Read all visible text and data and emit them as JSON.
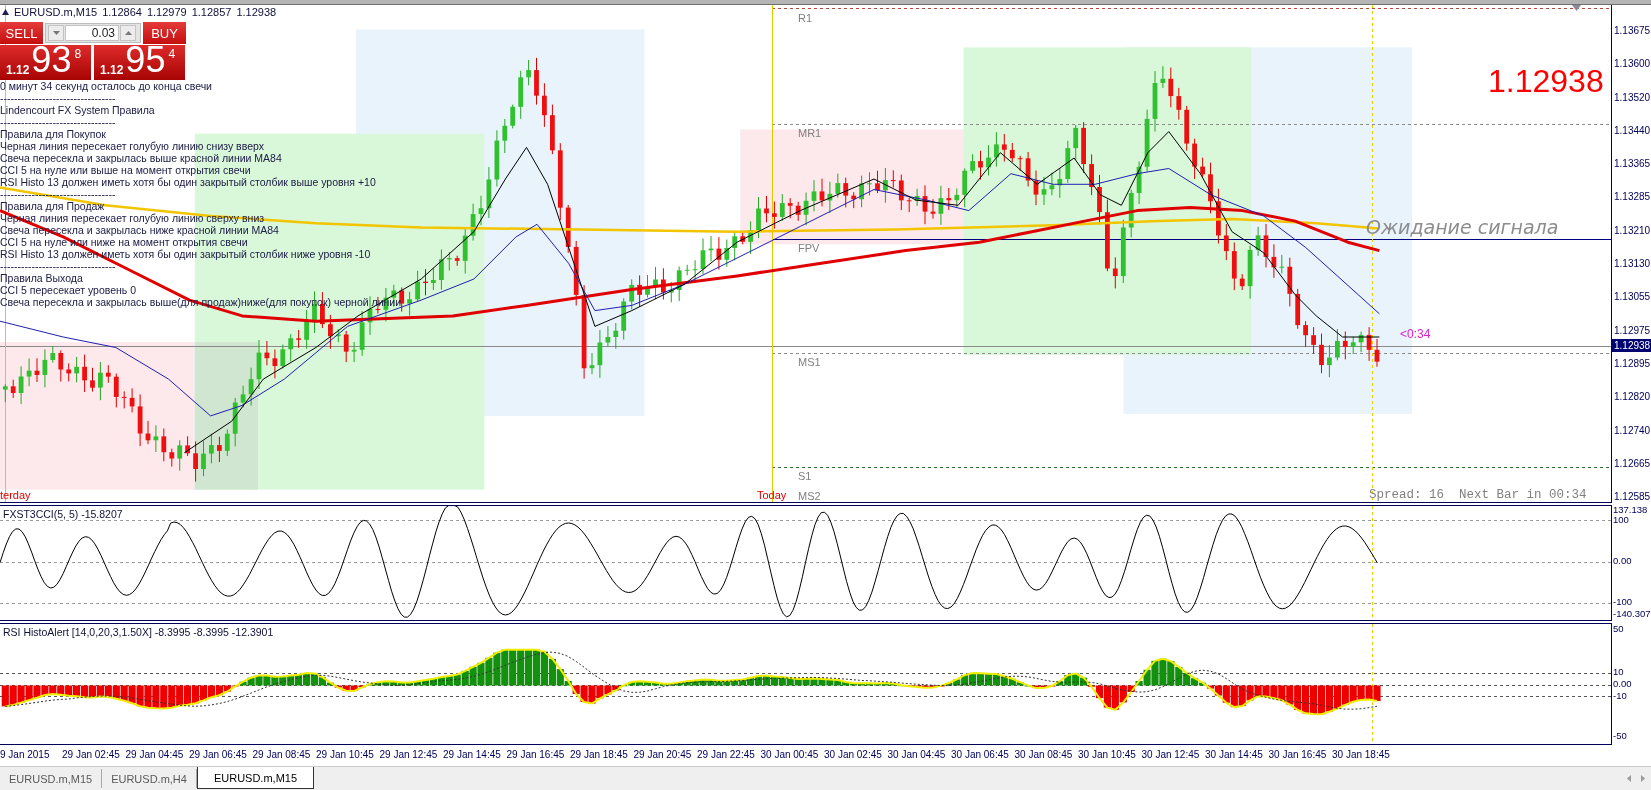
{
  "chart_header": {
    "symbol": "EURUSD.m,M15",
    "quotes": [
      "1.12864",
      "1.12979",
      "1.12857",
      "1.12938"
    ]
  },
  "trade_panel": {
    "sell_label": "SELL",
    "buy_label": "BUY",
    "lot": "0.03",
    "sell_quote": {
      "prefix": "1.12",
      "pips": "93",
      "fraction": "8"
    },
    "buy_quote": {
      "prefix": "1.12",
      "pips": "95",
      "fraction": "4"
    }
  },
  "info_lines": [
    "0 минут 34 секунд осталось до конца свечи",
    "---------------------------------",
    "Lindencourt FX System Правила",
    "---------------------------------",
    "Правила для Покупок",
    "Черная линия пересекает голубую линию снизу вверх",
    "Свеча пересекла и закрылась выше красной линии MA84",
    "CCI 5 на нуле или выше на момент открытия свечи",
    "RSI Histo 13 должен иметь хотя бы один закрытый столбик выше уровня +10",
    "---------------------------------",
    "Правила для Продаж",
    "Черная линия пересекает голубую линию сверху вниз",
    "Свеча пересекла и закрылась ниже красной линии MA84",
    "CCI 5 на нуле или ниже на момент открытия свечи",
    "RSI Histo 13 должен иметь хотя бы один закрытый столбик ниже уровня -10",
    "---------------------------------",
    "Правила Выхода",
    "CCI 5 пересекает уровень 0",
    "Свеча пересекла и закрылась выше(для продаж)ниже(для покупок) черной линии"
  ],
  "pivots": [
    {
      "label": "R1",
      "kind": "dashed",
      "color": "#b04a3a"
    },
    {
      "label": "MR1",
      "kind": "dashed",
      "color": "#8c8c8c"
    },
    {
      "label": "FPV",
      "kind": "solid",
      "color": "#000080"
    },
    {
      "label": "MS1",
      "kind": "dashed",
      "color": "#8c8c8c"
    },
    {
      "label": "S1",
      "kind": "dashed",
      "color": "#2e6b2e"
    },
    {
      "label": "MS2"
    }
  ],
  "day_labels": [
    "terday",
    "Today"
  ],
  "big_price": "1.12938",
  "timer": "<0:34",
  "signal_text": "Ожидание сигнала",
  "spread_text": "Spread: 16  Next Bar in 00:34",
  "price_axis": {
    "labels": [
      "1.13675",
      "1.13600",
      "1.13520",
      "1.13440",
      "1.13365",
      "1.13285",
      "1.13210",
      "1.13130",
      "1.13055",
      "1.12975",
      "1.12895",
      "1.12820",
      "1.12740",
      "1.12665",
      "1.12585"
    ],
    "current": "1.12938"
  },
  "cci": {
    "title": "FXST3CCI(5, 5) -15.8207",
    "axis_labels": [
      "137.138",
      "100",
      "0.00",
      "-100",
      "-140.307"
    ]
  },
  "rsi": {
    "title": "RSI HistoAlert [14,0,20,3,1.50X] -8.3995 -8.3995 -12.3901",
    "axis_labels": [
      "50",
      "10",
      "0.00",
      "-10",
      "-50"
    ]
  },
  "time_axis": [
    "9 Jan 2015",
    "29 Jan 02:45",
    "29 Jan 04:45",
    "29 Jan 06:45",
    "29 Jan 08:45",
    "29 Jan 10:45",
    "29 Jan 12:45",
    "29 Jan 14:45",
    "29 Jan 16:45",
    "29 Jan 18:45",
    "29 Jan 20:45",
    "29 Jan 22:45",
    "30 Jan 00:45",
    "30 Jan 02:45",
    "30 Jan 04:45",
    "30 Jan 06:45",
    "30 Jan 08:45",
    "30 Jan 10:45",
    "30 Jan 12:45",
    "30 Jan 14:45",
    "30 Jan 16:45",
    "30 Jan 18:45"
  ],
  "tabs": [
    {
      "label": "EURUSD.m,M15",
      "selected": false
    },
    {
      "label": "EURUSD.m,H4",
      "selected": false
    },
    {
      "label": "EURUSD.m,M15",
      "selected": true
    }
  ]
}
